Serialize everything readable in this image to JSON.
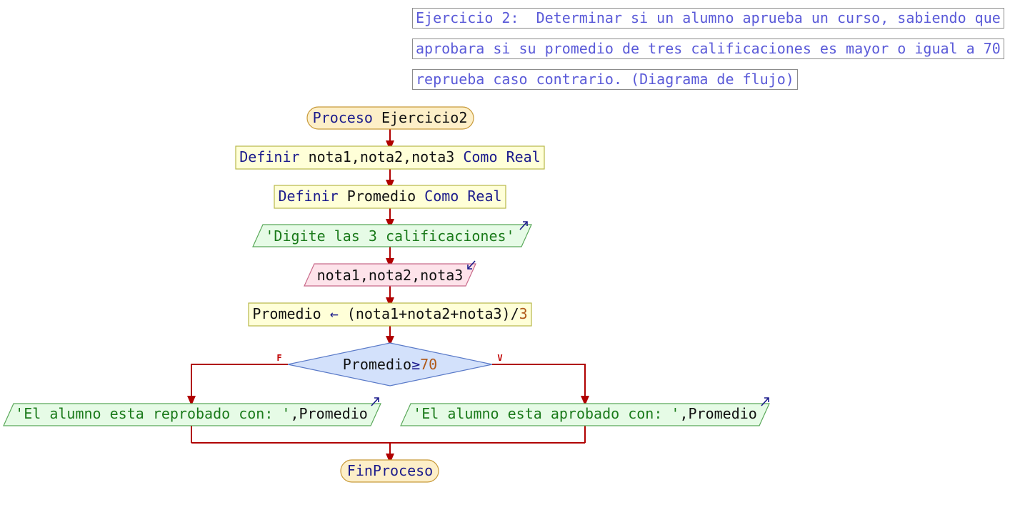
{
  "comments": [
    "Ejercicio 2:  Determinar si un alumno aprueba un curso, sabiendo que",
    "aprobara si su promedio de tres calificaciones es mayor o igual a 70",
    "reprueba caso contrario. (Diagrama de flujo)"
  ],
  "flow": {
    "start": {
      "keyword": "Proceso",
      "name": "Ejercicio2"
    },
    "define1": {
      "keyword": "Definir",
      "vars": "nota1,nota2,nota3",
      "como": "Como",
      "type": "Real"
    },
    "define2": {
      "keyword": "Definir",
      "vars": "Promedio",
      "como": "Como",
      "type": "Real"
    },
    "output1": {
      "text": "'Digite las 3 calificaciones'"
    },
    "input1": {
      "vars": "nota1,nota2,nota3"
    },
    "assign": {
      "target": "Promedio",
      "arrow": "←",
      "expr": "(nota1+nota2+nota3)/",
      "divisor": "3"
    },
    "decision": {
      "var": "Promedio",
      "op": "≥",
      "value": "70",
      "false_label": "F",
      "true_label": "V"
    },
    "output_false": {
      "text": "'El alumno esta reprobado con: '",
      "sep": ",",
      "var": "Promedio"
    },
    "output_true": {
      "text": "'El alumno esta aprobado con: '",
      "sep": ",",
      "var": "Promedio"
    },
    "end": {
      "keyword": "FinProceso"
    }
  },
  "colors": {
    "line": "#b00000",
    "terminal_fill": "#fdefc8",
    "terminal_stroke": "#c89a3a",
    "define_fill": "#ffffd8",
    "define_stroke": "#b8b84a",
    "output_fill": "#e6fbe6",
    "output_stroke": "#5aa85a",
    "input_fill": "#fde3ea",
    "input_stroke": "#c86a8a",
    "decision_fill": "#d3e1fb",
    "decision_stroke": "#5a7ac8"
  }
}
